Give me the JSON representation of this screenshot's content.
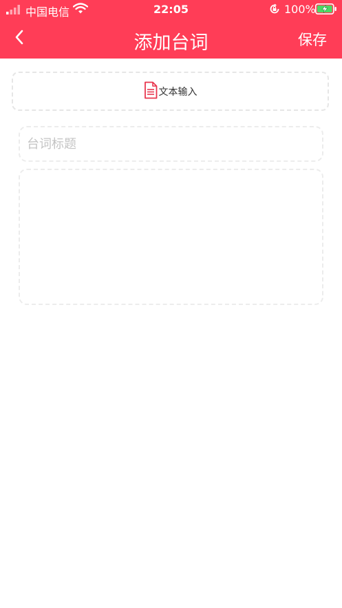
{
  "status_bar": {
    "carrier": "中国电信",
    "time": "22:05",
    "battery": "100%",
    "icons": [
      "signal-icon",
      "wifi-icon",
      "rotation-lock-icon",
      "battery-charging-icon"
    ]
  },
  "nav": {
    "title": "添加台词",
    "save_label": "保存",
    "back_icon": "chevron-left-icon"
  },
  "text_input_option": {
    "label": "文本输入",
    "icon": "document-icon"
  },
  "form": {
    "title_placeholder": "台词标题",
    "title_value": "",
    "content_value": ""
  },
  "colors": {
    "brand": "#ff3d57",
    "icon_accent": "#e8364e",
    "border": "#e6e6e6",
    "placeholder": "#c4c4c4"
  }
}
